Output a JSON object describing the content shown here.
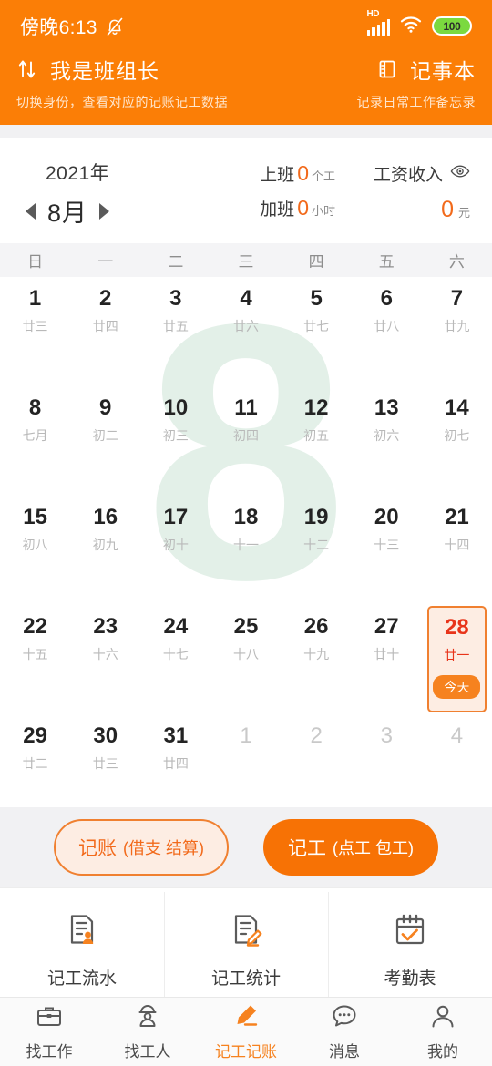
{
  "statusbar": {
    "time": "傍晚6:13",
    "bell_icon": "bell-off-icon",
    "network_label": "HD",
    "signal_icon": "signal-bars-icon",
    "wifi_icon": "wifi-icon",
    "battery_level": "100"
  },
  "header": {
    "swap_icon": "swap-vertical-icon",
    "title": "我是班组长",
    "subtitle": "切换身份，查看对应的记账记工数据",
    "notebook_icon": "notebook-icon",
    "notebook_label": "记事本",
    "notebook_sub": "记录日常工作备忘录"
  },
  "summary": {
    "year": "2021年",
    "month": "8月",
    "prev_icon": "chevron-left-icon",
    "next_icon": "chevron-right-icon",
    "work": {
      "label": "上班",
      "value": "0",
      "unit": "个工"
    },
    "overtime": {
      "label": "加班",
      "value": "0",
      "unit": "小时"
    },
    "salary": {
      "label": "工资收入",
      "eye_icon": "eye-icon",
      "value": "0",
      "unit": "元"
    }
  },
  "calendar": {
    "watermark": "8",
    "weekdays": [
      "日",
      "一",
      "二",
      "三",
      "四",
      "五",
      "六"
    ],
    "today_badge": "今天",
    "cells": [
      {
        "day": "1",
        "lunar": "廿三",
        "muted": false,
        "today": false
      },
      {
        "day": "2",
        "lunar": "廿四",
        "muted": false,
        "today": false
      },
      {
        "day": "3",
        "lunar": "廿五",
        "muted": false,
        "today": false
      },
      {
        "day": "4",
        "lunar": "廿六",
        "muted": false,
        "today": false
      },
      {
        "day": "5",
        "lunar": "廿七",
        "muted": false,
        "today": false
      },
      {
        "day": "6",
        "lunar": "廿八",
        "muted": false,
        "today": false
      },
      {
        "day": "7",
        "lunar": "廿九",
        "muted": false,
        "today": false
      },
      {
        "day": "8",
        "lunar": "七月",
        "muted": false,
        "today": false
      },
      {
        "day": "9",
        "lunar": "初二",
        "muted": false,
        "today": false
      },
      {
        "day": "10",
        "lunar": "初三",
        "muted": false,
        "today": false
      },
      {
        "day": "11",
        "lunar": "初四",
        "muted": false,
        "today": false
      },
      {
        "day": "12",
        "lunar": "初五",
        "muted": false,
        "today": false
      },
      {
        "day": "13",
        "lunar": "初六",
        "muted": false,
        "today": false
      },
      {
        "day": "14",
        "lunar": "初七",
        "muted": false,
        "today": false
      },
      {
        "day": "15",
        "lunar": "初八",
        "muted": false,
        "today": false
      },
      {
        "day": "16",
        "lunar": "初九",
        "muted": false,
        "today": false
      },
      {
        "day": "17",
        "lunar": "初十",
        "muted": false,
        "today": false
      },
      {
        "day": "18",
        "lunar": "十一",
        "muted": false,
        "today": false
      },
      {
        "day": "19",
        "lunar": "十二",
        "muted": false,
        "today": false
      },
      {
        "day": "20",
        "lunar": "十三",
        "muted": false,
        "today": false
      },
      {
        "day": "21",
        "lunar": "十四",
        "muted": false,
        "today": false
      },
      {
        "day": "22",
        "lunar": "十五",
        "muted": false,
        "today": false
      },
      {
        "day": "23",
        "lunar": "十六",
        "muted": false,
        "today": false
      },
      {
        "day": "24",
        "lunar": "十七",
        "muted": false,
        "today": false
      },
      {
        "day": "25",
        "lunar": "十八",
        "muted": false,
        "today": false
      },
      {
        "day": "26",
        "lunar": "十九",
        "muted": false,
        "today": false
      },
      {
        "day": "27",
        "lunar": "廿十",
        "muted": false,
        "today": false
      },
      {
        "day": "28",
        "lunar": "廿一",
        "muted": false,
        "today": true
      },
      {
        "day": "29",
        "lunar": "廿二",
        "muted": false,
        "today": false
      },
      {
        "day": "30",
        "lunar": "廿三",
        "muted": false,
        "today": false
      },
      {
        "day": "31",
        "lunar": "廿四",
        "muted": false,
        "today": false
      },
      {
        "day": "1",
        "lunar": "",
        "muted": true,
        "today": false
      },
      {
        "day": "2",
        "lunar": "",
        "muted": true,
        "today": false
      },
      {
        "day": "3",
        "lunar": "",
        "muted": true,
        "today": false
      },
      {
        "day": "4",
        "lunar": "",
        "muted": true,
        "today": false
      }
    ]
  },
  "actions": {
    "ledger": {
      "main": "记账",
      "sub": "(借支 结算)"
    },
    "worklog": {
      "main": "记工",
      "sub": "(点工 包工)"
    }
  },
  "features": [
    {
      "label": "记工流水",
      "icon": "document-person-icon"
    },
    {
      "label": "记工统计",
      "icon": "document-pencil-icon"
    },
    {
      "label": "考勤表",
      "icon": "calendar-check-icon"
    }
  ],
  "tabbar": [
    {
      "label": "找工作",
      "icon": "briefcase-icon",
      "active": false
    },
    {
      "label": "找工人",
      "icon": "worker-icon",
      "active": false
    },
    {
      "label": "记工记账",
      "icon": "pencil-icon",
      "active": true
    },
    {
      "label": "消息",
      "icon": "chat-bubble-icon",
      "active": false
    },
    {
      "label": "我的",
      "icon": "person-icon",
      "active": false
    }
  ],
  "colors": {
    "brand_orange": "#FB7E06",
    "accent_orange": "#F6821F",
    "today_red": "#E8341A",
    "today_bg": "#FDEDE3",
    "watermark_green": "#E3F0E8",
    "band_gray": "#F1F1F3"
  }
}
